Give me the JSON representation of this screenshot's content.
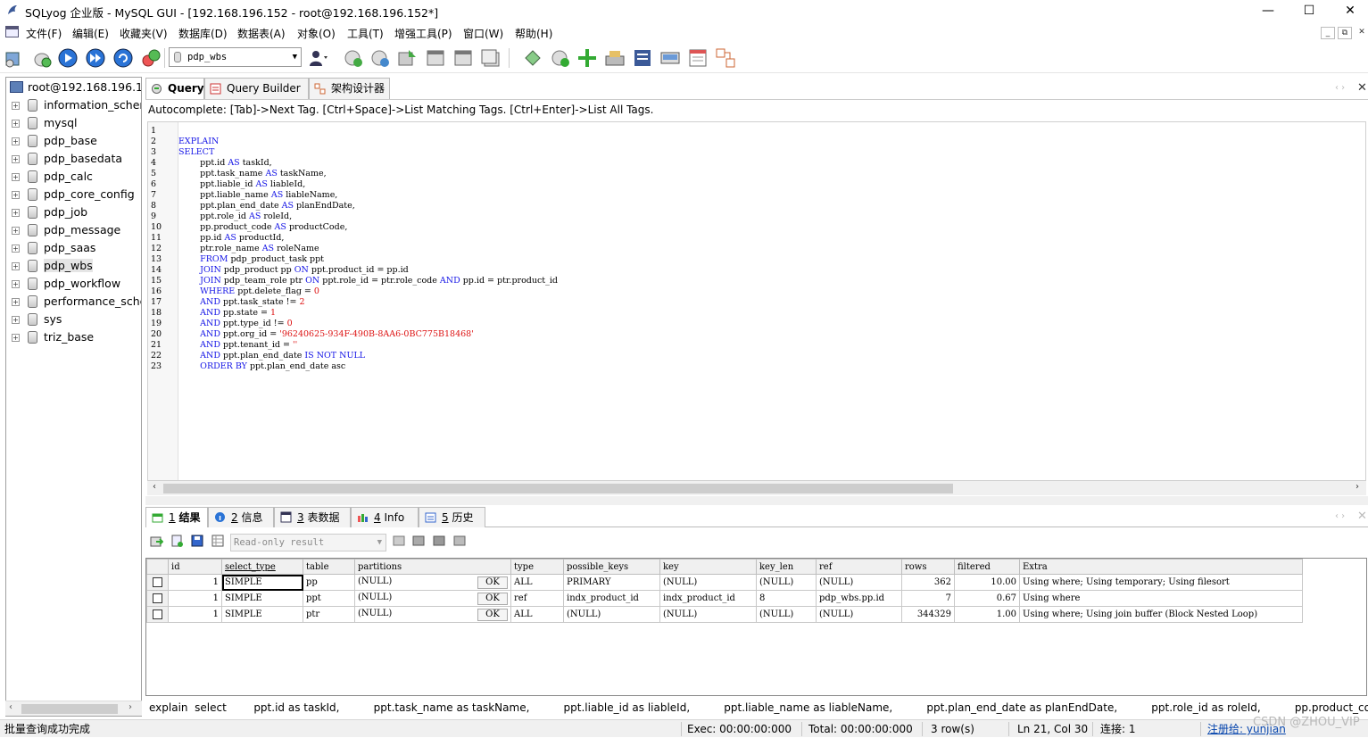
{
  "window": {
    "title": "SQLyog 企业版 - MySQL GUI - [192.168.196.152 - root@192.168.196.152*]",
    "minimize": "—",
    "maximize": "☐",
    "close": "✕"
  },
  "menu": [
    "文件(F)",
    "编辑(E)",
    "收藏夹(V)",
    "数据库(D)",
    "数据表(A)",
    "对象(O)",
    "工具(T)",
    "增强工具(P)",
    "窗口(W)",
    "帮助(H)"
  ],
  "mdi_buttons": [
    "_",
    "⧉",
    "✕"
  ],
  "toolbar": {
    "database_selector": "pdp_wbs"
  },
  "tree": {
    "root": "root@192.168.196.152",
    "items": [
      "information_schema",
      "mysql",
      "pdp_base",
      "pdp_basedata",
      "pdp_calc",
      "pdp_core_config",
      "pdp_job",
      "pdp_message",
      "pdp_saas",
      "pdp_wbs",
      "pdp_workflow",
      "performance_schema",
      "sys",
      "triz_base"
    ],
    "selected": "pdp_wbs"
  },
  "query_tabs": [
    "Query",
    "Query Builder",
    "架构设计器"
  ],
  "autocomplete_hint": "Autocomplete: [Tab]->Next Tag. [Ctrl+Space]->List Matching Tags. [Ctrl+Enter]->List All Tags.",
  "editor": {
    "line_numbers": [
      "1",
      "2",
      "3",
      "4",
      "5",
      "6",
      "7",
      "8",
      "9",
      "10",
      "11",
      "12",
      "13",
      "14",
      "15",
      "16",
      "17",
      "18",
      "19",
      "20",
      "21",
      "22",
      "23"
    ]
  },
  "result_tabs": [
    {
      "num": "1",
      "label": "结果"
    },
    {
      "num": "2",
      "label": "信息"
    },
    {
      "num": "3",
      "label": "表数据"
    },
    {
      "num": "4",
      "label": "Info"
    },
    {
      "num": "5",
      "label": "历史"
    }
  ],
  "result_mode": "Read-only result",
  "result": {
    "columns": [
      "id",
      "select_type",
      "table",
      "partitions",
      "type",
      "possible_keys",
      "key",
      "key_len",
      "ref",
      "rows",
      "filtered",
      "Extra"
    ],
    "ok_label": "OK",
    "rows": [
      [
        "1",
        "SIMPLE",
        "pp",
        "(NULL)",
        "ALL",
        "PRIMARY",
        "(NULL)",
        "(NULL)",
        "(NULL)",
        "362",
        "10.00",
        "Using where; Using temporary; Using filesort"
      ],
      [
        "1",
        "SIMPLE",
        "ppt",
        "(NULL)",
        "ref",
        "indx_product_id",
        "indx_product_id",
        "8",
        "pdp_wbs.pp.id",
        "7",
        "0.67",
        "Using where"
      ],
      [
        "1",
        "SIMPLE",
        "ptr",
        "(NULL)",
        "ALL",
        "(NULL)",
        "(NULL)",
        "(NULL)",
        "(NULL)",
        "344329",
        "1.00",
        "Using where; Using join buffer (Block Nested Loop)"
      ]
    ]
  },
  "sql_preview": "explain  select        ppt.id as taskId,          ppt.task_name as taskName,          ppt.liable_id as liableId,          ppt.liable_name as liableName,          ppt.plan_end_date as planEndDate,          ppt.role_id as roleId,          pp.product_cod...",
  "status": {
    "message": "批量查询成功完成",
    "exec": "Exec: 00:00:00:000",
    "total": "Total: 00:00:00:000",
    "rows": "3 row(s)",
    "position": "Ln 21, Col 30",
    "connections": "连接: 1",
    "register": "注册给: yunjian"
  },
  "watermark": "CSDN @ZHOU_VIP",
  "colors": {
    "keyword": "#1515e6",
    "string": "#d11111",
    "link": "#0645ad"
  }
}
